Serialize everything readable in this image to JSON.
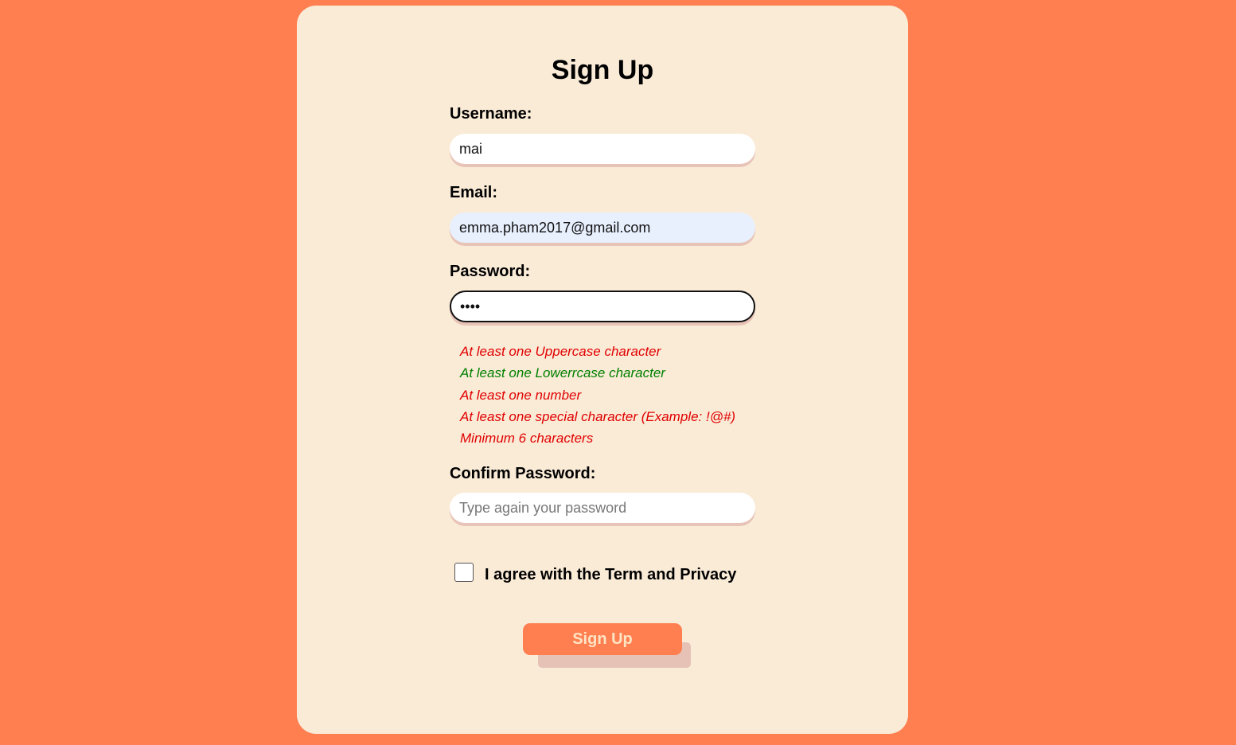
{
  "page": {
    "title": "Sign Up",
    "background_color": "#ff7f50",
    "card_color": "#faebd7"
  },
  "form": {
    "username": {
      "label": "Username:",
      "value": "mai"
    },
    "email": {
      "label": "Email:",
      "value": "emma.pham2017@gmail.com"
    },
    "password": {
      "label": "Password:",
      "value": "••••"
    },
    "password_rules": [
      {
        "text": "At least one Uppercase character",
        "satisfied": false
      },
      {
        "text": "At least one Lowerrcase character",
        "satisfied": true
      },
      {
        "text": "At least one number",
        "satisfied": false
      },
      {
        "text": "At least one special character (Example: !@#)",
        "satisfied": false
      },
      {
        "text": "Minimum 6 characters",
        "satisfied": false
      }
    ],
    "confirm_password": {
      "label": "Confirm Password:",
      "placeholder": "Type again your password",
      "value": ""
    },
    "agree": {
      "label": "I agree with the Term and Privacy",
      "checked": false
    },
    "submit_label": "Sign Up"
  },
  "colors": {
    "rule_unmet": "#e00000",
    "rule_met": "#008000",
    "button_bg": "#ff7f50",
    "button_text": "#ffe4c4"
  }
}
